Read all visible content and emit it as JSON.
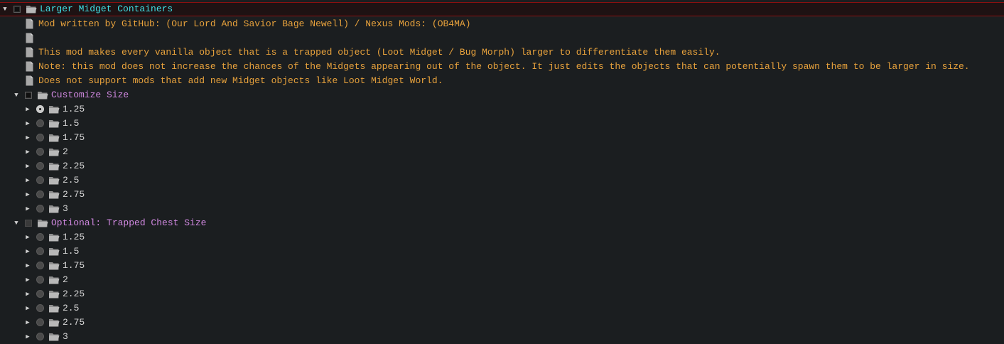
{
  "root": {
    "title": "Larger Midget Containers",
    "expanded": true,
    "checked": true,
    "info_lines": [
      "Mod written by GitHub: (Our Lord And Savior Bage Newell) / Nexus Mods: (OB4MA)",
      "",
      "This mod makes every vanilla object that is a trapped object (Loot Midget / Bug Morph) larger to differentiate them easily.",
      "Note: this mod does not increase the chances of the Midgets appearing out of the object.  It just edits the objects that can potentially spawn them to be larger in size.",
      "Does not support mods that add new Midget objects like Loot Midget World."
    ]
  },
  "groups": [
    {
      "title": "Customize Size",
      "checked": true,
      "options": [
        "1.25",
        "1.5",
        "1.75",
        "2",
        "2.25",
        "2.5",
        "2.75",
        "3"
      ],
      "selected": 0
    },
    {
      "title": "Optional: Trapped Chest Size",
      "checked": false,
      "options": [
        "1.25",
        "1.5",
        "1.75",
        "2",
        "2.25",
        "2.5",
        "2.75",
        "3"
      ],
      "selected": -1
    }
  ],
  "icons": {
    "expanded": "triangle-down-icon",
    "collapsed": "triangle-right-icon",
    "folder": "folder-open-icon",
    "file": "file-icon",
    "radio": "radio-icon",
    "checkbox": "checkbox-icon"
  },
  "colors": {
    "background": "#1b1e20",
    "root_title": "#3fe0e6",
    "group_title": "#d088e0",
    "info_text": "#e8a23c",
    "option_text": "#d4d4d4",
    "root_border": "#8a1010"
  }
}
